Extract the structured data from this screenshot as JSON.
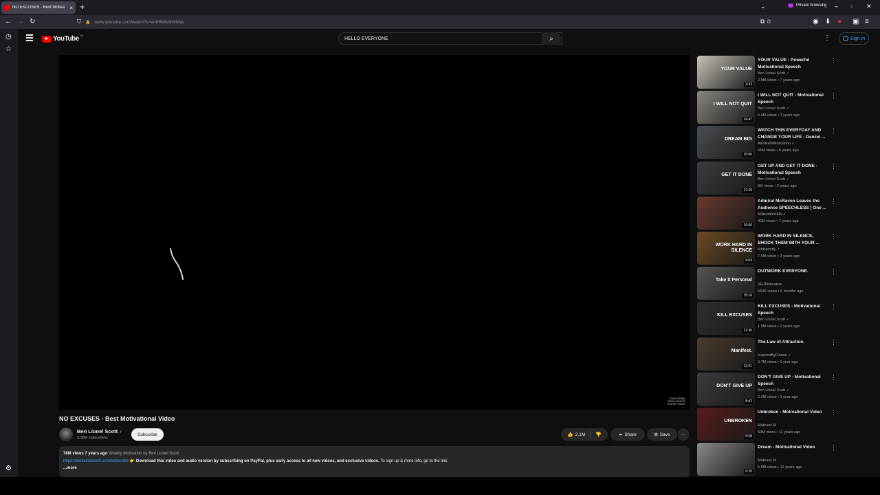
{
  "browser": {
    "tab_title": "NO EXCUSES - Best Motiva",
    "tab_close": "×",
    "new_tab": "+",
    "tabs_menu": "⌄",
    "private_label": "Private browsing",
    "win_min": "–",
    "win_max": "▫",
    "win_close": "✕",
    "back": "←",
    "forward": "→",
    "reload": "↻",
    "shield": "⛉",
    "lock": "🔒",
    "url": "www.youtube.com/watch?v=wnHW6o8WMas",
    "url_tools": "⧉  ☆",
    "ext1": "◉",
    "ext2": "⬇",
    "ext3": "⧩",
    "ext4": "●",
    "ext5": "▣",
    "menu": "≡",
    "side_history": "◷",
    "side_bookmarks": "☆",
    "side_settings": "⚙"
  },
  "yt": {
    "logo_text": "YouTube",
    "logo_cc": "GK",
    "search_value": "HELLO EVERYONE",
    "clear": "✕",
    "search_icon": "⌕",
    "kebab": "⋮",
    "signin": "Sign in"
  },
  "video": {
    "title": "NO EXCUSES - Best Motivational Video",
    "channel": "Ben Lionel Scott",
    "verified": "✓",
    "subscribers": "3.38M subscribers",
    "subscribe": "Subscribe",
    "likes": "2.1M",
    "like_icon": "👍",
    "dislike_icon": "👎",
    "share": "Share",
    "share_icon": "➦",
    "save": "Save",
    "save_icon": "⊞",
    "more_icon": "⋯",
    "watermark": "SUBSCRIBE\nNEW VIDEOS\nEVERY WEEK"
  },
  "description": {
    "views": "76M views",
    "age": "7 years ago",
    "tag": "Weekly Motivation by Ben Lionel Scott",
    "link": "https://benlionelscott.com/subscribe",
    "emoji": "👉",
    "bold_text": "Download this video and audio version by subscribing on PayPal, plus early access to all new videos, and exclusive videos.",
    "tail": "To sign up & more info, go to the link.",
    "more": "...more"
  },
  "recommendations": [
    {
      "title": "YOUR VALUE - Powerful Motivational Speech",
      "channel": "Ben Lionel Scott",
      "verified": true,
      "meta": "2.8M views • 7 years ago",
      "duration": "3:33",
      "thumb_text": "YOUR VALUE",
      "thumb_color": "#c8c2b8"
    },
    {
      "title": "I WILL NOT QUIT - Motivational Speech",
      "channel": "Ben Lionel Scott",
      "verified": true,
      "meta": "6.4M views • 2 years ago",
      "duration": "24:47",
      "thumb_text": "I WILL NOT QUIT",
      "thumb_color": "#8a8680"
    },
    {
      "title": "WATCH THIS EVERYDAY AND CHANGE YOUR LIFE - Denzel ...",
      "channel": "AlexKaltsMotivation",
      "verified": true,
      "meta": "65M views • 6 years ago",
      "duration": "10:06",
      "thumb_text": "DREAM BIG",
      "thumb_color": "#4a4e52"
    },
    {
      "title": "GET UP AND GET IT DONE - Motivational Speech",
      "channel": "Ben Lionel Scott",
      "verified": true,
      "meta": "5M views • 2 years ago",
      "duration": "21:29",
      "thumb_text": "GET IT DONE",
      "thumb_color": "#3a3c40"
    },
    {
      "title": "Admiral McRaven Leaves the Audience SPEECHLESS | One ...",
      "channel": "MotivationHub",
      "verified": true,
      "meta": "40M views • 7 years ago",
      "duration": "16:00",
      "thumb_text": "",
      "thumb_color": "#6a3a30"
    },
    {
      "title": "WORK HARD IN SILENCE, SHOCK THEM WITH YOUR ...",
      "channel": "Motiversity",
      "verified": true,
      "meta": "7.5M views • 3 years ago",
      "duration": "9:04",
      "thumb_text": "WORK HARD IN SILENCE",
      "thumb_color": "#6b4a22"
    },
    {
      "title": "OUTWORK EVERYONE.",
      "channel": "SRJMotivation",
      "verified": false,
      "meta": "683K views • 6 months ago",
      "duration": "15:16",
      "thumb_text": "Take it Personal",
      "thumb_color": "#555555"
    },
    {
      "title": "KILL EXCUSES - Motivational Speech",
      "channel": "Ben Lionel Scott",
      "verified": true,
      "meta": "1.5M views • 2 years ago",
      "duration": "22:30",
      "thumb_text": "KILL EXCUSES",
      "thumb_color": "#2e2e2e"
    },
    {
      "title": "The Law of Attraction.",
      "channel": "InspiredByFlorian",
      "verified": true,
      "meta": "3.7M views • 1 year ago",
      "duration": "22:31",
      "thumb_text": "Manifest.",
      "thumb_color": "#4a3c2e"
    },
    {
      "title": "DON'T GIVE UP - Motivational Speech",
      "channel": "Ben Lionel Scott",
      "verified": true,
      "meta": "2.2M views • 1 year ago",
      "duration": "8:42",
      "thumb_text": "DON'T GIVE UP",
      "thumb_color": "#3c3c3c"
    },
    {
      "title": "Unbroken - Motivational Video",
      "channel": "Mateusz M",
      "verified": false,
      "meta": "50M views • 11 years ago",
      "duration": "5:58",
      "thumb_text": "UNBROKEN",
      "thumb_color": "#5a1a1a"
    },
    {
      "title": "Dream - Motivational Video",
      "channel": "Mateusz M",
      "verified": false,
      "meta": "5.5M views • 12 years ago",
      "duration": "6:20",
      "thumb_text": "",
      "thumb_color": "#8a8a8a"
    }
  ]
}
